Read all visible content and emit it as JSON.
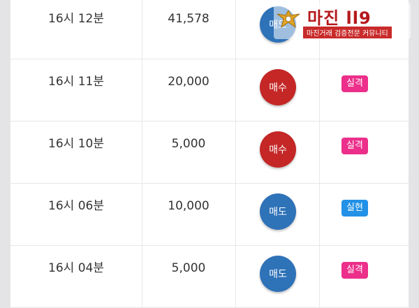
{
  "rows": [
    {
      "time": "16시 12분",
      "quantity": "41,578",
      "side": "매도",
      "side_type": "sell",
      "result": "",
      "result_type": ""
    },
    {
      "time": "16시 11분",
      "quantity": "20,000",
      "side": "매수",
      "side_type": "buy",
      "result": "실격",
      "result_type": "fail"
    },
    {
      "time": "16시 10분",
      "quantity": "5,000",
      "side": "매수",
      "side_type": "buy",
      "result": "실격",
      "result_type": "fail"
    },
    {
      "time": "16시 06분",
      "quantity": "10,000",
      "side": "매도",
      "side_type": "sell",
      "result": "실현",
      "result_type": "hit"
    },
    {
      "time": "16시 04분",
      "quantity": "5,000",
      "side": "매도",
      "side_type": "sell",
      "result": "실격",
      "result_type": "fail"
    }
  ],
  "watermark": {
    "title": "마진 ll9",
    "subtitle": "마진거래 검증전문 커뮤니티"
  },
  "colors": {
    "sell": "#2e72b8",
    "buy": "#c42726",
    "fail_badge": "#ec2f8a",
    "hit_badge": "#2291e6"
  }
}
